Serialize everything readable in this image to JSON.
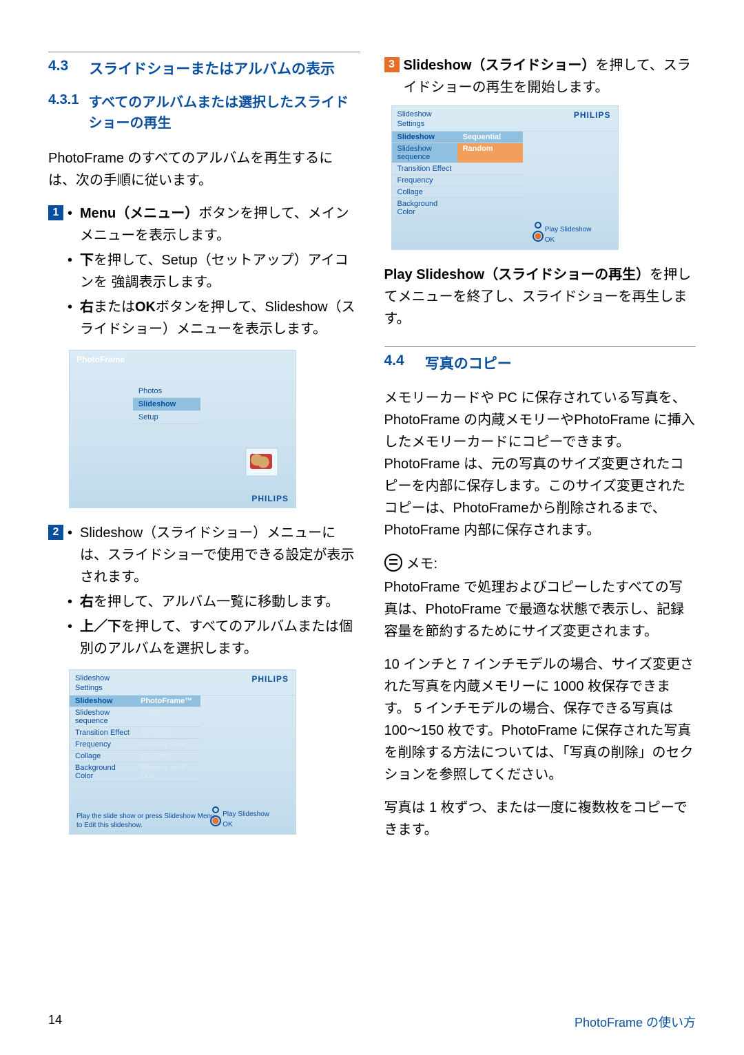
{
  "section43": {
    "number": "4.3",
    "title": "スライドショーまたはアルバムの表示",
    "sub431_number": "4.3.1",
    "sub431_title": "すべてのアルバムまたは選択したスライドショーの再生",
    "intro": "PhotoFrame のすべてのアルバムを再生するには、次の手順に従います。",
    "step1": {
      "bullet1_a": "Menu（メニュー）",
      "bullet1_b": "ボタンを押して、メインメニューを表示します。",
      "bullet2_a": "下",
      "bullet2_b": "を押して、Setup（セットアップ）アイコンを 強調表示します。",
      "bullet3_a": "右",
      "bullet3_mid": "または",
      "bullet3_ok": "OK",
      "bullet3_b": "ボタンを押して、Slideshow（スライドショー）メニューを表示します。"
    },
    "device1": {
      "title": "PhotoFrame",
      "items": [
        "Photos",
        "Slideshow",
        "Setup"
      ],
      "brand": "PHILIPS"
    },
    "step2": {
      "intro": "Slideshow（スライドショー）メニューには、スライドショーで使用できる設定が表示されます。",
      "bullet1_a": "右",
      "bullet1_b": "を押して、アルバム一覧に移動します。",
      "bullet2_a": "上／下",
      "bullet2_b": "を押して、すべてのアルバムまたは個別のアルバムを選択します。"
    },
    "device2": {
      "title": "Slideshow",
      "subtitle": "Settings",
      "left": [
        "Slideshow",
        "Slideshow sequence",
        "Transition Effect",
        "Frequency",
        "Collage",
        "Background Color"
      ],
      "right": [
        "PhotoFrame™",
        "SD/MMC Card",
        "CF Card",
        "Memory stick",
        "xD Card",
        "Memory stick Duo"
      ],
      "brand": "PHILIPS",
      "tip1": "Play the slide show or press Slideshow Menu",
      "tip2": "to Edit this slideshow.",
      "right_btn1": "Play Slideshow",
      "right_btn2": "OK"
    },
    "step3": {
      "lead_a": "Slideshow（スライドショー）",
      "lead_b": "を押して、スライドショーの再生を開始します。"
    },
    "device3": {
      "title": "Slideshow",
      "subtitle": "Settings",
      "left": [
        "Slideshow",
        "Slideshow sequence",
        "Transition Effect",
        "Frequency",
        "Collage",
        "Background Color"
      ],
      "right_top": "Sequential",
      "right_sel": "Random",
      "brand": "PHILIPS",
      "right_btn1": "Play Slideshow",
      "right_btn2": "OK"
    },
    "play_line_a": "Play Slideshow（スライドショーの再生）",
    "play_line_b": "を押してメニューを終了し、スライドショーを再生します。"
  },
  "section44": {
    "number": "4.4",
    "title": "写真のコピー",
    "para1": "メモリーカードや PC に保存されている写真を、PhotoFrame の内蔵メモリーやPhotoFrame に挿入したメモリーカードにコピーできます。PhotoFrame は、元の写真のサイズ変更されたコピーを内部に保存します。このサイズ変更されたコピーは、PhotoFrameから削除されるまで、PhotoFrame 内部に保存されます。",
    "note_label": "メモ:",
    "note_body": "PhotoFrame で処理およびコピーしたすべての写真は、PhotoFrame で最適な状態で表示し、記録容量を節約するためにサイズ変更されます。",
    "para2": "10 インチと 7 インチモデルの場合、サイズ変更された写真を内蔵メモリーに 1000 枚保存できます。 5 インチモデルの場合、保存できる写真は 100〜150 枚です。PhotoFrame に保存された写真を削除する方法については、「写真の削除」のセクションを参照してください。",
    "para3": "写真は 1 枚ずつ、または一度に複数枚をコピーできます。"
  },
  "footer": {
    "page": "14",
    "right": "PhotoFrame の使い方"
  }
}
